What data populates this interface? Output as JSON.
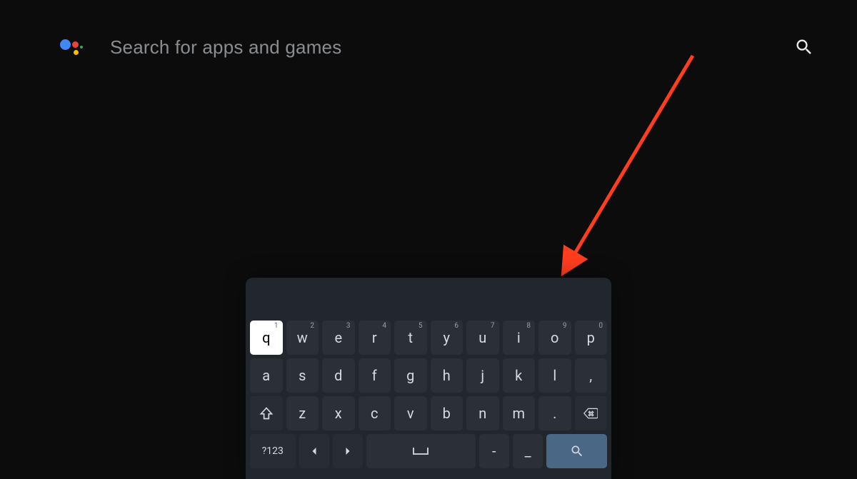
{
  "search": {
    "placeholder": "Search for apps and games",
    "value": ""
  },
  "keyboard": {
    "row1": [
      {
        "label": "q",
        "sup": "1",
        "focused": true
      },
      {
        "label": "w",
        "sup": "2"
      },
      {
        "label": "e",
        "sup": "3"
      },
      {
        "label": "r",
        "sup": "4"
      },
      {
        "label": "t",
        "sup": "5"
      },
      {
        "label": "y",
        "sup": "6"
      },
      {
        "label": "u",
        "sup": "7"
      },
      {
        "label": "i",
        "sup": "8"
      },
      {
        "label": "o",
        "sup": "9"
      },
      {
        "label": "p",
        "sup": "0"
      }
    ],
    "row2": [
      {
        "label": "a"
      },
      {
        "label": "s"
      },
      {
        "label": "d"
      },
      {
        "label": "f"
      },
      {
        "label": "g"
      },
      {
        "label": "h"
      },
      {
        "label": "j"
      },
      {
        "label": "k"
      },
      {
        "label": "l"
      },
      {
        "label": ","
      }
    ],
    "row3_letters": [
      {
        "label": "z"
      },
      {
        "label": "x"
      },
      {
        "label": "c"
      },
      {
        "label": "v"
      },
      {
        "label": "b"
      },
      {
        "label": "n"
      },
      {
        "label": "m"
      },
      {
        "label": "."
      }
    ],
    "symbols_key_label": "?123",
    "dash_label": "-",
    "underscore_label": "_"
  },
  "annotation": {
    "arrow_color": "#ff3d1f"
  }
}
